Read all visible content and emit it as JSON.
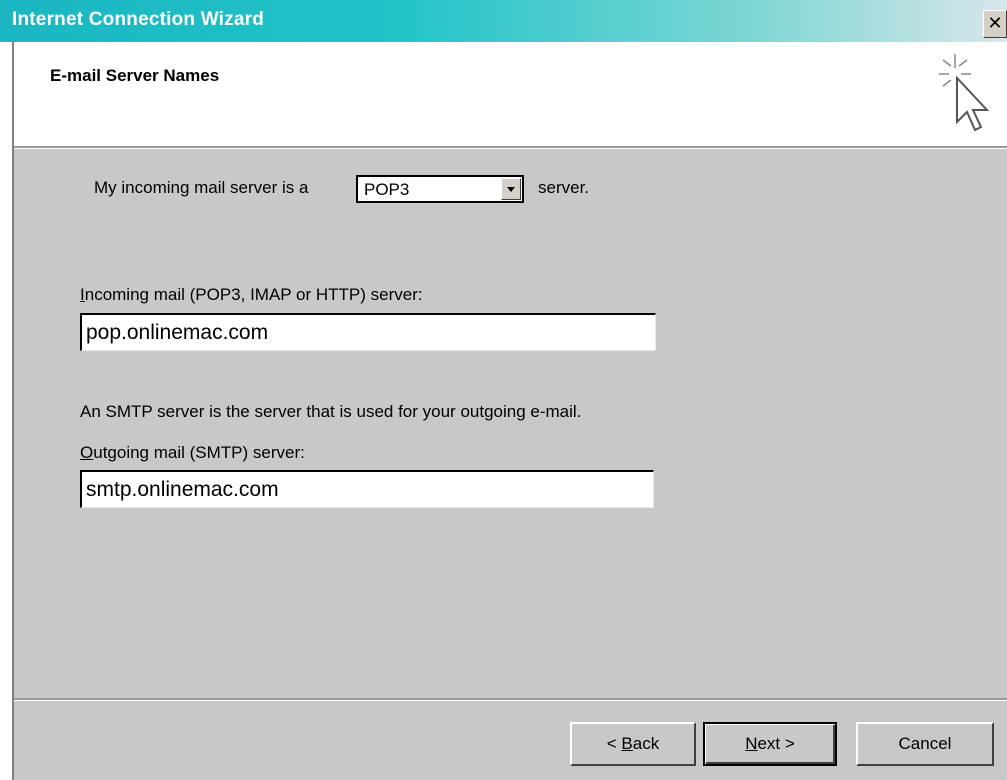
{
  "window": {
    "title": "Internet Connection Wizard",
    "close_glyph": "✕"
  },
  "header": {
    "title": "E-mail Server Names",
    "icon": "wizard-cursor-sparkle-icon"
  },
  "form": {
    "incoming_type_prefix": "My incoming mail server is a",
    "incoming_type_value": "POP3",
    "incoming_type_suffix": "server.",
    "incoming_label_access": "I",
    "incoming_label_rest": "ncoming mail (POP3, IMAP or HTTP) server:",
    "incoming_value": "pop.onlinemac.com",
    "smtp_note": "An SMTP server is the server that is used for your outgoing e-mail.",
    "outgoing_label_access": "O",
    "outgoing_label_rest": "utgoing mail (SMTP) server:",
    "outgoing_value": "smtp.onlinemac.com"
  },
  "buttons": {
    "back_prefix": "< ",
    "back_access": "B",
    "back_rest": "ack",
    "next_access": "N",
    "next_rest": "ext >",
    "cancel": "Cancel"
  },
  "colors": {
    "titlebar_start": "#1ab6c2",
    "dialog_face": "#c8c8c8"
  }
}
